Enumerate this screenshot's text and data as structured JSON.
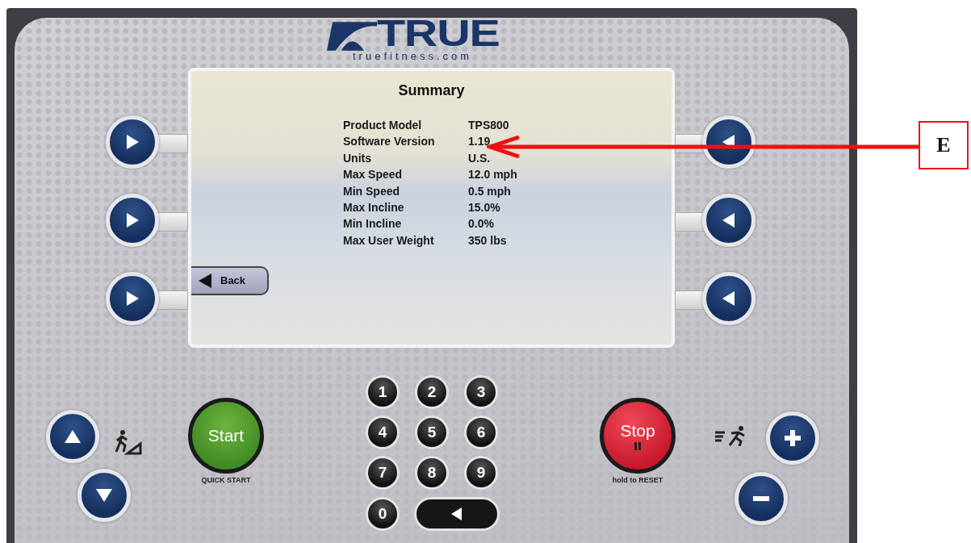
{
  "logo": {
    "wordmark": "TRUE",
    "url": "truefitness.com"
  },
  "screen": {
    "title": "Summary",
    "rows": [
      {
        "label": "Product Model",
        "value": "TPS800"
      },
      {
        "label": "Software Version",
        "value": "1.19"
      },
      {
        "label": "Units",
        "value": "U.S."
      },
      {
        "label": "Max Speed",
        "value": "12.0 mph"
      },
      {
        "label": "Min Speed",
        "value": "0.5 mph"
      },
      {
        "label": "Max Incline",
        "value": "15.0%"
      },
      {
        "label": "Min Incline",
        "value": "0.0%"
      },
      {
        "label": "Max User Weight",
        "value": "350 lbs"
      }
    ],
    "back_button": "Back"
  },
  "keypad": {
    "keys": [
      "1",
      "2",
      "3",
      "4",
      "5",
      "6",
      "7",
      "8",
      "9",
      "0"
    ]
  },
  "start_button": {
    "label": "Start",
    "caption": "QUICK START"
  },
  "stop_button": {
    "label": "Stop",
    "caption": "hold to RESET"
  },
  "callout": {
    "label": "E"
  }
}
